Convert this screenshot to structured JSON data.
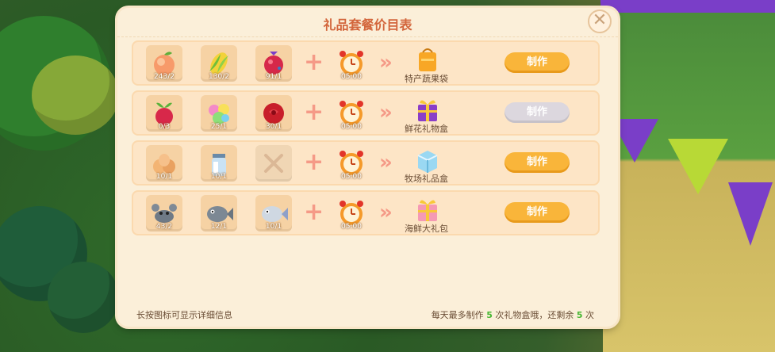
{
  "panel": {
    "title": "礼品套餐价目表",
    "footer_hint": "长按图标可显示详细信息",
    "footer_limit": {
      "prefix": "每天最多制作 ",
      "max": "5",
      "middle": " 次礼物盒哦，还剩余 ",
      "remaining": "5",
      "suffix": " 次"
    }
  },
  "recipes": [
    {
      "ingredients": [
        {
          "icon": "peach-icon",
          "qty": "243/2"
        },
        {
          "icon": "corn-icon",
          "qty": "130/2"
        },
        {
          "icon": "red-fruit-icon",
          "qty": "91/1"
        }
      ],
      "time": "05:00",
      "result": {
        "icon": "orange-bag-icon",
        "name": "特产蔬果袋"
      },
      "button": {
        "label": "制作",
        "enabled": true
      }
    },
    {
      "ingredients": [
        {
          "icon": "radish-icon",
          "qty": "0/3"
        },
        {
          "icon": "candy-flowers-icon",
          "qty": "25/1"
        },
        {
          "icon": "rose-icon",
          "qty": "30/1"
        }
      ],
      "time": "05:00",
      "result": {
        "icon": "purple-gift-box-icon",
        "name": "鲜花礼物盒"
      },
      "button": {
        "label": "制作",
        "enabled": false
      }
    },
    {
      "ingredients": [
        {
          "icon": "eggs-icon",
          "qty": "10/1"
        },
        {
          "icon": "milk-jar-icon",
          "qty": "10/1"
        },
        {
          "icon": "empty-slot-icon",
          "qty": ""
        }
      ],
      "time": "05:00",
      "result": {
        "icon": "ice-cube-box-icon",
        "name": "牧场礼品盒"
      },
      "button": {
        "label": "制作",
        "enabled": true
      }
    },
    {
      "ingredients": [
        {
          "icon": "crab-icon",
          "qty": "43/2"
        },
        {
          "icon": "gray-fish-icon",
          "qty": "12/1"
        },
        {
          "icon": "silver-fish-icon",
          "qty": "10/1"
        }
      ],
      "time": "05:00",
      "result": {
        "icon": "pink-gift-box-icon",
        "name": "海鲜大礼包"
      },
      "button": {
        "label": "制作",
        "enabled": true
      }
    }
  ]
}
